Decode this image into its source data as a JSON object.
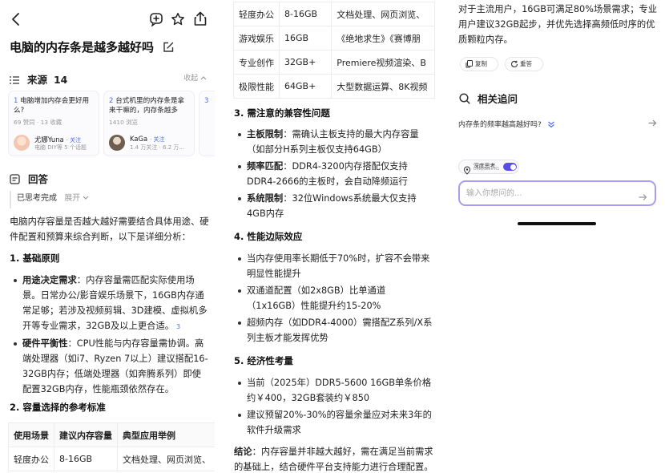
{
  "header": {
    "title": "电脑的内存条是越多越好吗"
  },
  "sources": {
    "label": "来源",
    "count": "14",
    "collapse": "收起"
  },
  "cards": [
    {
      "num": "1",
      "title": "电脑增加内存会更好用么?",
      "meta": "69 赞同 · 13 收藏",
      "author": "尤娜Yuna",
      "follow": "· 关注",
      "desc": "电脑 DIY等 5 个话题",
      "avatar_color": "#f3c6b0"
    },
    {
      "num": "2",
      "title": "台式机里的内存条是拿来干嘛的，内存条越多越...",
      "meta": "1410 浏览",
      "author": "KaGa",
      "follow": "· 关注",
      "desc": "1.4 万关注 · 6.2 万...",
      "avatar_color": "#7a6a5c"
    },
    {
      "num": "3",
      "title": "",
      "meta": "",
      "author": "",
      "follow": "",
      "desc": "",
      "avatar_color": "#dddddd"
    }
  ],
  "answer": {
    "label": "回答",
    "think_done": "已思考完成",
    "expand": "展开",
    "intro": "电脑内存容量是否越大越好需要结合具体用途、硬件配置和预算来综合判断，以下是详细分析：",
    "s1_title": "1. 基础原则",
    "s1_items": [
      {
        "bold": "用途决定需求",
        "text": "：内存容量需匹配实际使用场景。日常办公/影音娱乐场景下，16GB内存通常足够；若涉及视频剪辑、3D建模、虚拟机多开等专业需求，32GB及以上更合适。",
        "cite": "3"
      },
      {
        "bold": "硬件平衡性",
        "text": "：CPU性能与内存容量需协调。高端处理器（如i7、Ryzen 7以上）建议搭配16-32GB内存；低端处理器（如奔腾系列）即使配置32GB内存，性能瓶颈依然存在。",
        "cite": ""
      }
    ],
    "s2_title": "2. 容量选择的参考标准",
    "table": {
      "headers": [
        "使用场景",
        "建议内存容量",
        "典型应用举例"
      ],
      "rows": [
        [
          "轻度办公",
          "8-16GB",
          "文档处理、网页浏览、"
        ],
        [
          "游戏娱乐",
          "16GB",
          "《绝地求生》《赛博朋"
        ],
        [
          "专业创作",
          "32GB+",
          "Premiere视频渲染、B"
        ],
        [
          "极限性能",
          "64GB+",
          "大型数据运算、8K视频"
        ]
      ]
    },
    "s3_title": "3. 需注意的兼容性问题",
    "s3_items": [
      {
        "bold": "主板限制",
        "text": "：需确认主板支持的最大内存容量（如部分H系列主板仅支持64GB）"
      },
      {
        "bold": "频率匹配",
        "text": "：DDR4-3200内存搭配仅支持DDR4-2666的主板时，会自动降频运行"
      },
      {
        "bold": "系统限制",
        "text": "：32位Windows系统最大仅支持4GB内存"
      }
    ],
    "s4_title": "4. 性能边际效应",
    "s4_items": [
      "当内存使用率长期低于70%时，扩容不会带来明显性能提升",
      "双通道配置（如2x8GB）比单通道（1x16GB）性能提升约15-20%",
      "超频内存（如DDR4-4000）需搭配Z系列/X系列主板才能发挥优势"
    ],
    "s5_title": "5. 经济性考量",
    "s5_items": [
      "当前（2025年）DDR5-5600 16GB单条价格约￥400，32GB套装约￥850",
      "建议预留20%-30%的容量余量应对未来3年的软件升级需求"
    ],
    "conclusion_bold": "结论",
    "conclusion": "：内存容量并非越大越好，需在满足当前需求的基础上，结合硬件平台支持能力进行合理配置。",
    "tail": "对于主流用户，16GB可满足80%场景需求；专业用户建议32GB起步，并优先选择高频低时序的优质颗粒内存。"
  },
  "actions": {
    "copy": "复制",
    "regen": "重答"
  },
  "related": {
    "label": "相关追问",
    "items": [
      "内存条的频率越高越好吗?"
    ]
  },
  "deep_think": {
    "label": "深度思考",
    "sub": "DeepSeek R1",
    "enabled": true
  },
  "input": {
    "placeholder": "输入你想问的..."
  },
  "colors": {
    "accent": "#4a6cf7",
    "toggle": "#5b4cf0",
    "input_border": "#a89cf5"
  }
}
